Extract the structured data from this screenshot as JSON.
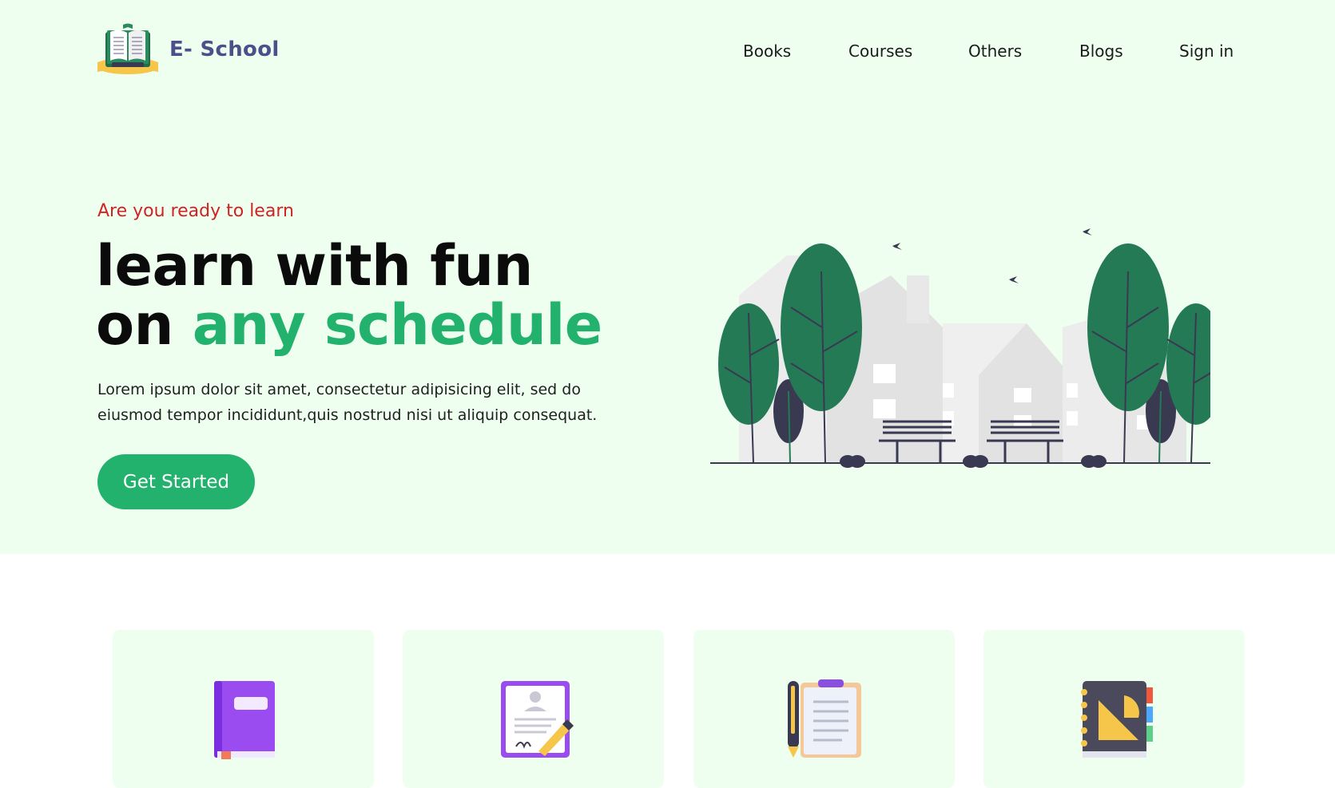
{
  "brand": {
    "name": "E- School"
  },
  "nav": {
    "items": [
      {
        "label": "Books"
      },
      {
        "label": "Courses"
      },
      {
        "label": "Others"
      },
      {
        "label": "Blogs"
      },
      {
        "label": "Sign in"
      }
    ]
  },
  "hero": {
    "kicker": "Are you ready to learn",
    "headline_line1": "learn with fun",
    "headline_line2_plain": "on ",
    "headline_line2_accent": "any schedule",
    "description": "Lorem ipsum dolor sit amet, consectetur adipisicing elit, sed do eiusmod tempor incididunt,quis nostrud nisi ut aliquip consequat.",
    "cta_label": "Get Started"
  },
  "features": {
    "cards": [
      {
        "icon": "book-icon"
      },
      {
        "icon": "document-sign-icon"
      },
      {
        "icon": "clipboard-pen-icon"
      },
      {
        "icon": "notebook-ruler-icon"
      }
    ]
  },
  "colors": {
    "hero_bg": "#efffef",
    "accent_green": "#23b26d",
    "kicker_red": "#d02424",
    "brand_text": "#4b4f8a",
    "tree_green": "#237a55",
    "dark_navy": "#3a3952"
  }
}
